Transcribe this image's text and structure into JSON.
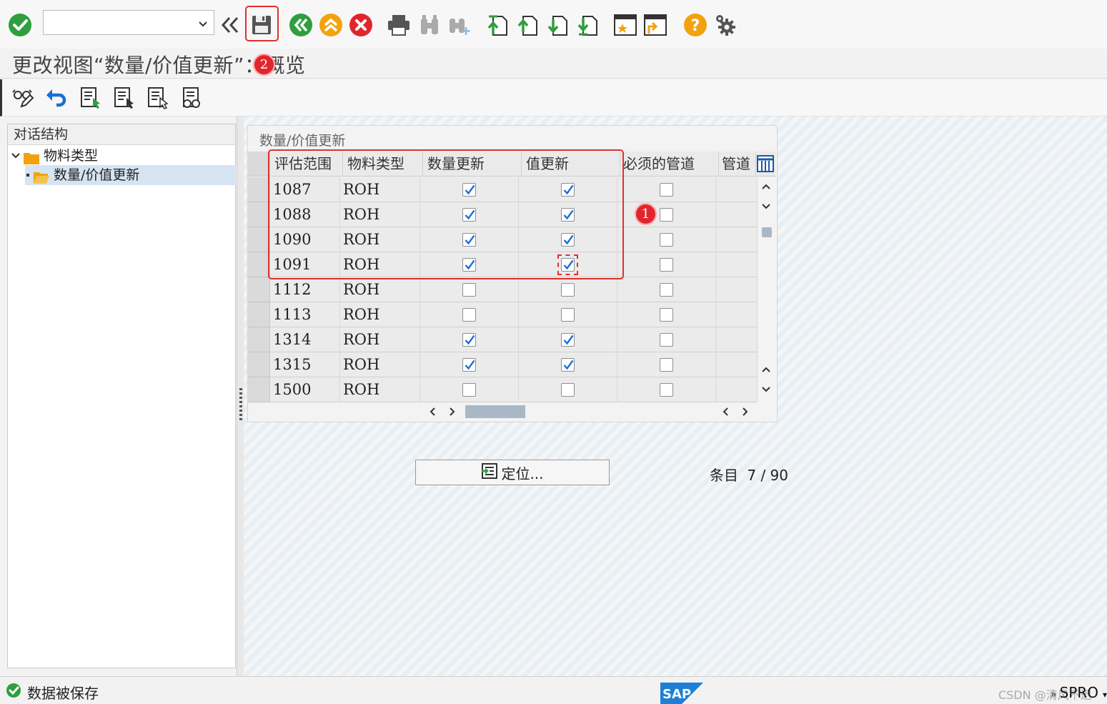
{
  "toolbar": {
    "command_field_value": "",
    "icons": [
      "enter-icon",
      "command-dropdown-icon",
      "back-double-chevron-icon",
      "save-icon",
      "back-icon",
      "exit-icon",
      "cancel-icon",
      "print-icon",
      "find-icon",
      "find-next-icon",
      "first-page-icon",
      "previous-page-icon",
      "next-page-icon",
      "last-page-icon",
      "new-session-icon",
      "shortcut-icon",
      "help-icon",
      "settings-icon"
    ]
  },
  "title": {
    "text": "更改视图“数量/价值更新”：概览",
    "badge_save": "2"
  },
  "app_toolbar": {
    "icons": [
      "display-change-icon",
      "undo-icon",
      "new-entries-icon",
      "copy-as-icon",
      "delete-icon",
      "select-all-icon"
    ]
  },
  "tree": {
    "header": "对话结构",
    "items": [
      {
        "label": "物料类型",
        "level": 0,
        "expanded": true
      },
      {
        "label": "数量/价值更新",
        "level": 1,
        "selected": true
      }
    ]
  },
  "table": {
    "caption": "数量/价值更新",
    "columns": [
      "评估范围",
      "物料类型",
      "数量更新",
      "值更新",
      "必须的管道",
      "管道"
    ],
    "rows": [
      {
        "area": "1087",
        "type": "ROH",
        "qty": true,
        "val": true,
        "pipe": false
      },
      {
        "area": "1088",
        "type": "ROH",
        "qty": true,
        "val": true,
        "pipe": false
      },
      {
        "area": "1090",
        "type": "ROH",
        "qty": true,
        "val": true,
        "pipe": false
      },
      {
        "area": "1091",
        "type": "ROH",
        "qty": true,
        "val": true,
        "pipe": false
      },
      {
        "area": "1112",
        "type": "ROH",
        "qty": false,
        "val": false,
        "pipe": false
      },
      {
        "area": "1113",
        "type": "ROH",
        "qty": false,
        "val": false,
        "pipe": false
      },
      {
        "area": "1314",
        "type": "ROH",
        "qty": true,
        "val": true,
        "pipe": false
      },
      {
        "area": "1315",
        "type": "ROH",
        "qty": true,
        "val": true,
        "pipe": false
      },
      {
        "area": "1500",
        "type": "ROH",
        "qty": false,
        "val": false,
        "pipe": false
      }
    ],
    "badge_rows": "1"
  },
  "locate_button": "定位...",
  "entry": {
    "label": "条目",
    "current": "7",
    "separator": " / ",
    "total": "90"
  },
  "status": {
    "message": "数据被保存",
    "tcode": "SPRO",
    "watermark": "CSDN @清风不迟",
    "logo_text": "SAP"
  },
  "colors": {
    "accent_green": "#2e9e3e",
    "accent_orange": "#f2a20c",
    "accent_red": "#e0262c",
    "check_blue": "#1a6fd6",
    "sap_blue": "#1d7fd6"
  }
}
